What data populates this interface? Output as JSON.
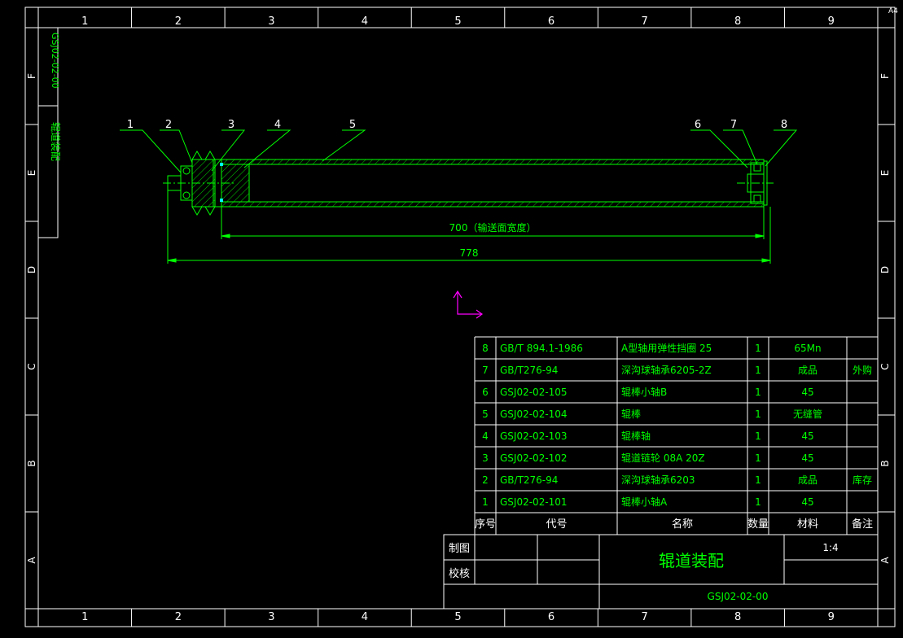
{
  "sheet": {
    "size_label": "A4",
    "col_labels": [
      "1",
      "2",
      "3",
      "4",
      "5",
      "6",
      "7",
      "8",
      "9"
    ],
    "row_labels": [
      "F",
      "E",
      "D",
      "C",
      "B",
      "A"
    ]
  },
  "side_block": {
    "code": "GSJ02-02-00",
    "name": "辊道装配"
  },
  "callouts": [
    "1",
    "2",
    "3",
    "4",
    "5",
    "6",
    "7",
    "8"
  ],
  "dimensions": {
    "conveyor_width": "700（输送面宽度）",
    "overall_length": "778"
  },
  "bom": {
    "header": {
      "seq": "序号",
      "code": "代号",
      "name": "名称",
      "qty": "数量",
      "material": "材料",
      "remark": "备注"
    },
    "rows": [
      {
        "seq": "8",
        "code": "GB/T 894.1-1986",
        "name": "A型轴用弹性挡圈 25",
        "qty": "1",
        "material": "65Mn",
        "remark": ""
      },
      {
        "seq": "7",
        "code": "GB/T276-94",
        "name": "深沟球轴承6205-2Z",
        "qty": "1",
        "material": "成品",
        "remark": "外购"
      },
      {
        "seq": "6",
        "code": "GSJ02-02-105",
        "name": "辊棒小轴B",
        "qty": "1",
        "material": "45",
        "remark": ""
      },
      {
        "seq": "5",
        "code": "GSJ02-02-104",
        "name": "辊棒",
        "qty": "1",
        "material": "无缝管",
        "remark": ""
      },
      {
        "seq": "4",
        "code": "GSJ02-02-103",
        "name": "辊棒轴",
        "qty": "1",
        "material": "45",
        "remark": ""
      },
      {
        "seq": "3",
        "code": "GSJ02-02-102",
        "name": "辊道链轮 08A 20Z",
        "qty": "1",
        "material": "45",
        "remark": ""
      },
      {
        "seq": "2",
        "code": "GB/T276-94",
        "name": "深沟球轴承6203",
        "qty": "1",
        "material": "成品",
        "remark": "库存"
      },
      {
        "seq": "1",
        "code": "GSJ02-02-101",
        "name": "辊棒小轴A",
        "qty": "1",
        "material": "45",
        "remark": ""
      }
    ]
  },
  "title_block": {
    "drawn_label": "制图",
    "checked_label": "校核",
    "title": "辊道装配",
    "scale": "1:4",
    "drawing_no": "GSJ02-02-00"
  },
  "colors": {
    "border": "#ffffff",
    "drawing": "#00ff00",
    "hatch": "#00ff00",
    "ucs": "#ff00ff",
    "accent": "#00ffff"
  }
}
